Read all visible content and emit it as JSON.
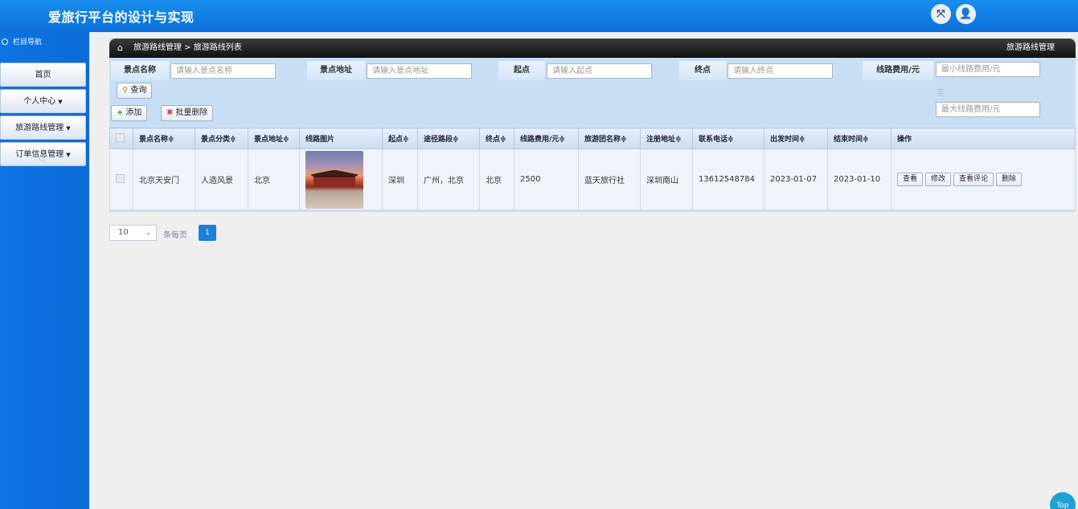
{
  "header": {
    "title": "爱旅行平台的设计与实现",
    "fullscreen_icon": "⤧",
    "user_icon": "👤"
  },
  "sidebar": {
    "heading": "栏目导航",
    "items": [
      {
        "label": "首页",
        "caret": ""
      },
      {
        "label": "个人中心",
        "caret": "▼"
      },
      {
        "label": "旅游路线管理",
        "caret": "▼"
      },
      {
        "label": "订单信息管理",
        "caret": "▼"
      }
    ]
  },
  "breadcrumb": {
    "home_icon": "⌂",
    "path": "旅游路线管理 > 旅游路线列表",
    "section": "旅游路线管理"
  },
  "search": {
    "fields": [
      {
        "label": "景点名称",
        "placeholder": "请输入景点名称"
      },
      {
        "label": "景点地址",
        "placeholder": "请输入景点地址"
      },
      {
        "label": "起点",
        "placeholder": "请输入起点"
      },
      {
        "label": "终点",
        "placeholder": "请输入终点"
      },
      {
        "label": "线路费用/元",
        "placeholder_min": "最小线路费用/元",
        "placeholder_max": "最大线路费用/元",
        "to": "至"
      }
    ],
    "query_button": "查询"
  },
  "toolbar": {
    "add": "添加",
    "batch_delete": "批量删除"
  },
  "table": {
    "headers": [
      "景点名称",
      "景点分类",
      "景点地址",
      "线路图片",
      "起点",
      "途径路段",
      "终点",
      "线路费用/元",
      "旅游团名称",
      "注册地址",
      "联系电话",
      "出发时间",
      "结束时间",
      "操作"
    ],
    "sort_mark": "≑",
    "rows": [
      {
        "name": "北京天安门",
        "category": "人造风景",
        "address": "北京",
        "start": "深圳",
        "via": "广州，北京",
        "end": "北京",
        "fee": "2500",
        "group": "蓝天旅行社",
        "reg_address": "深圳南山",
        "phone": "13612548784",
        "depart": "2023-01-07",
        "finish": "2023-01-10",
        "actions": [
          "查看",
          "修改",
          "查看评论",
          "删除"
        ]
      }
    ]
  },
  "pager": {
    "page_size": "10",
    "per_page_label": "条每页",
    "current": "1"
  },
  "top_button": "Top"
}
